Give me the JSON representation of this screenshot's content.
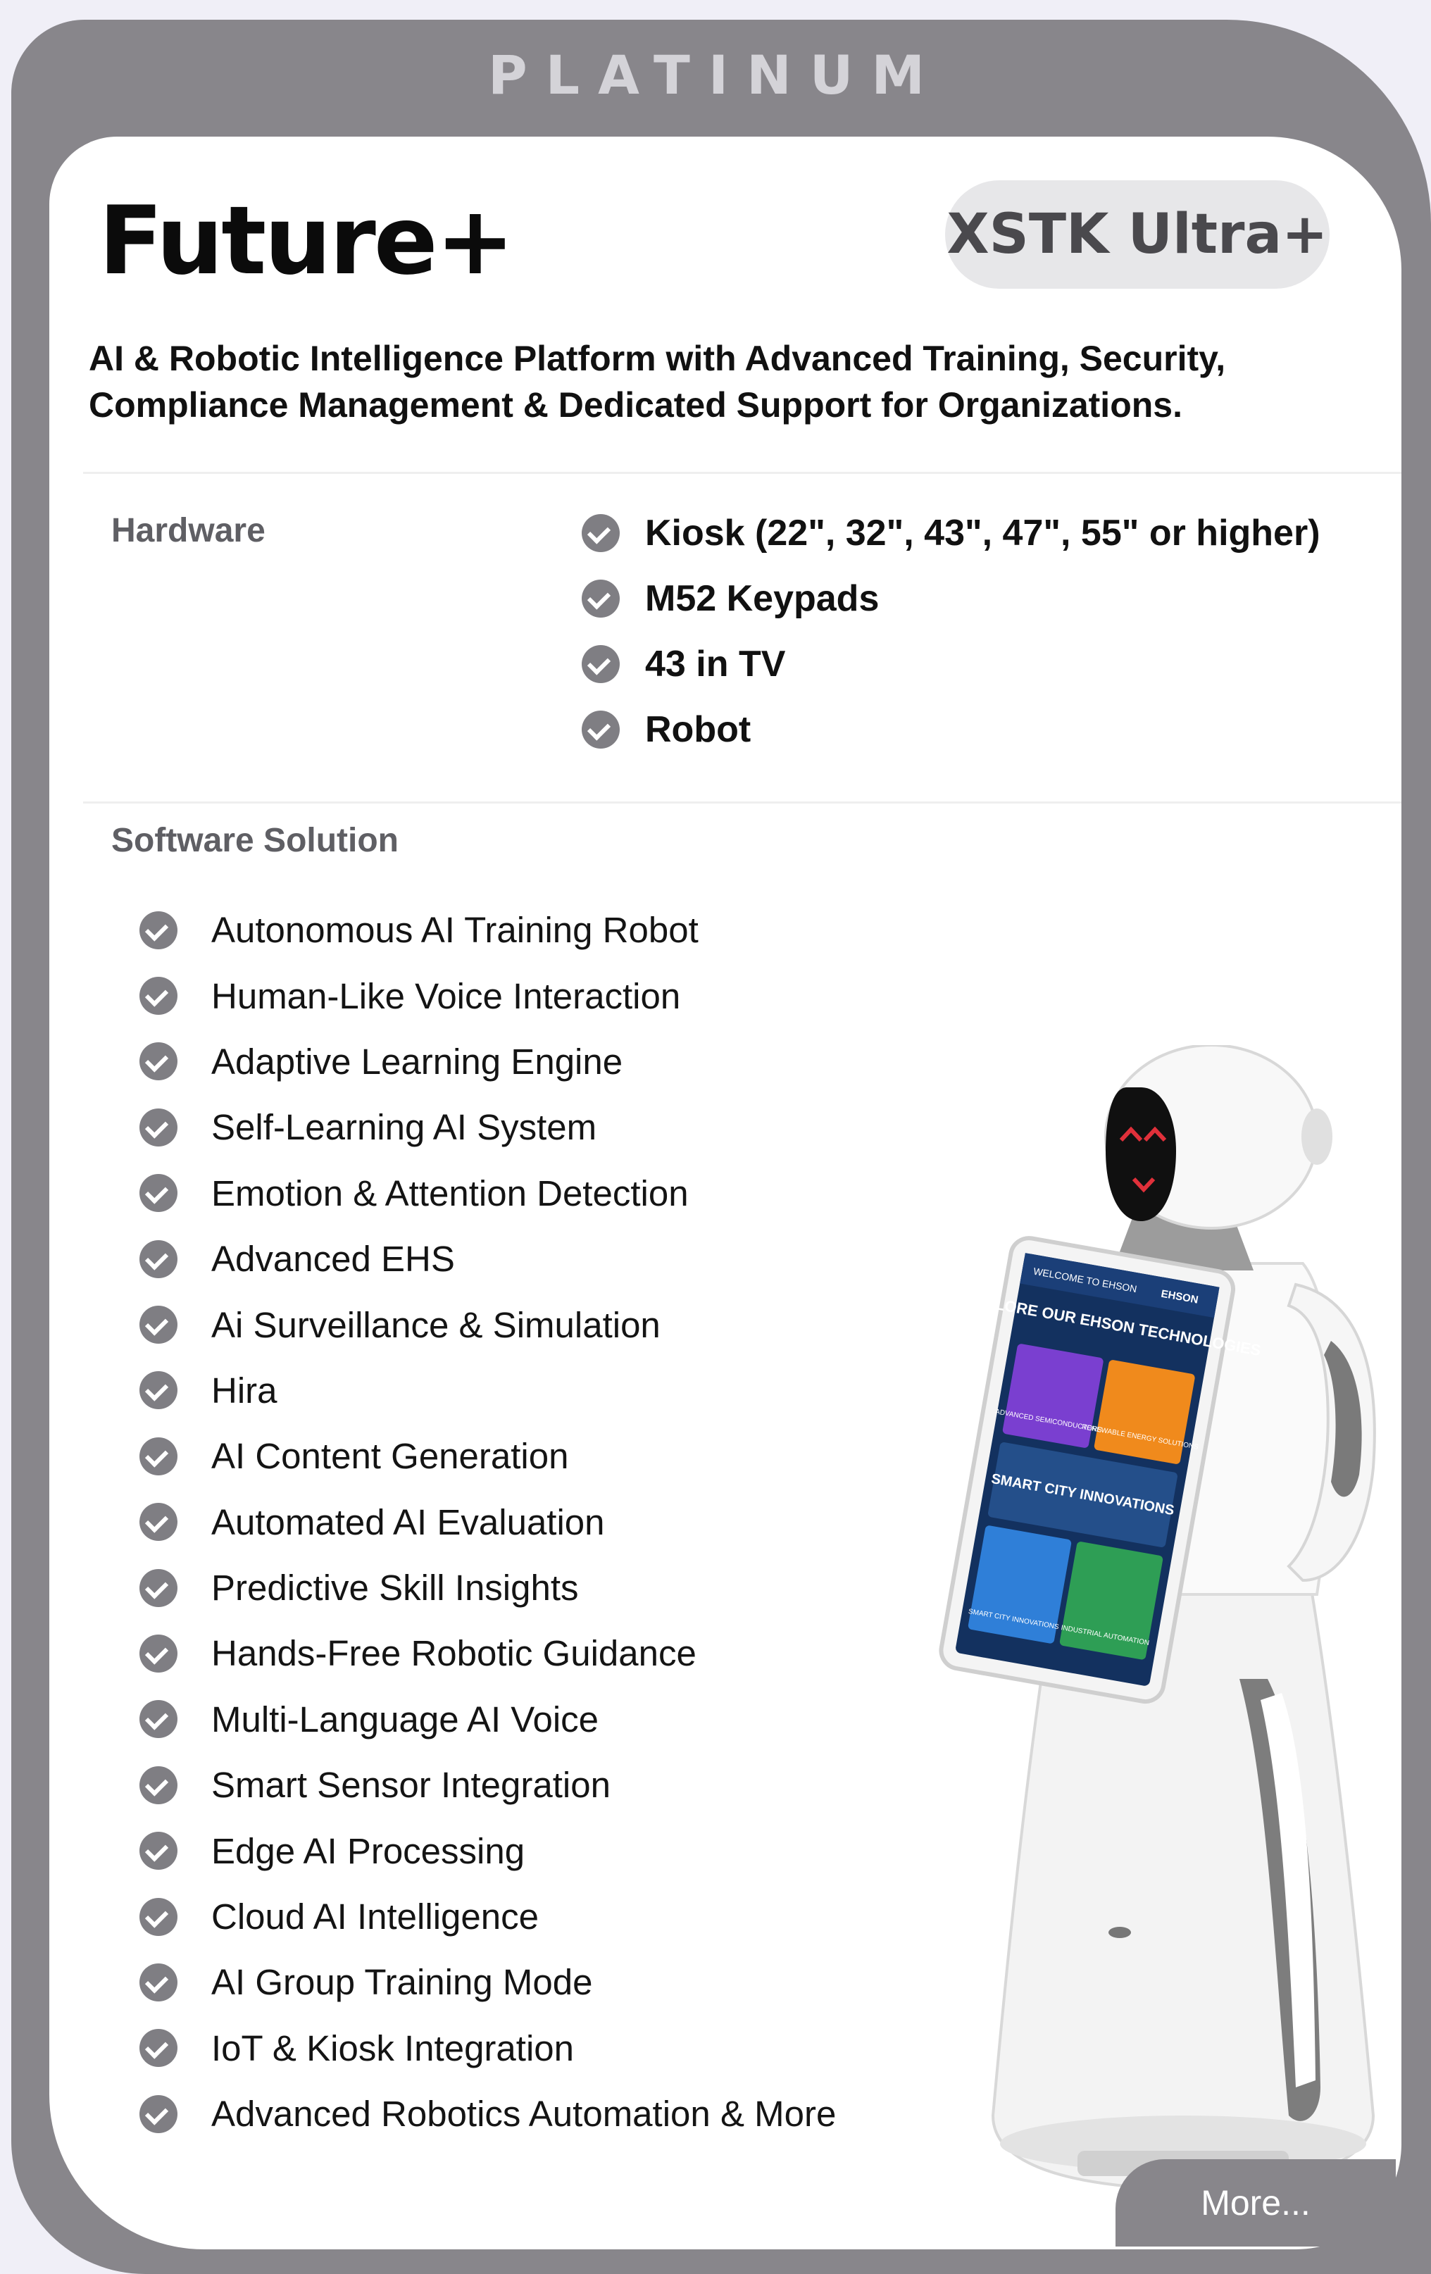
{
  "tier": "PLATINUM",
  "plan": {
    "title": "Future+",
    "model": "XSTK Ultra+",
    "description": "AI & Robotic Intelligence Platform with Advanced Training, Security, Compliance Management & Dedicated Support for Organizations."
  },
  "hardware": {
    "label": "Hardware",
    "items": [
      "Kiosk (22\", 32\", 43\", 47\", 55\" or higher)",
      "M52 Keypads",
      "43 in TV",
      "Robot"
    ]
  },
  "software": {
    "label": "Software Solution",
    "items": [
      "Autonomous AI Training Robot",
      "Human-Like Voice Interaction",
      "Adaptive Learning Engine",
      "Self-Learning AI System",
      "Emotion & Attention Detection",
      "Advanced EHS",
      "Ai Surveillance & Simulation",
      "Hira",
      "AI Content Generation",
      "Automated AI Evaluation",
      "Predictive Skill Insights",
      "Hands-Free Robotic Guidance",
      "Multi-Language AI Voice",
      "Smart Sensor Integration",
      "Edge AI Processing",
      "Cloud AI Intelligence",
      "AI Group Training Mode",
      "IoT & Kiosk Integration",
      "Advanced Robotics Automation & More"
    ]
  },
  "robot_screen": {
    "welcome": "WELCOME TO EHSON",
    "brand": "EHSON",
    "headline": "EXPLORE OUR EHSON TECHNOLOGIES",
    "tiles": [
      "ADVANCED SEMICONDUCTORS",
      "RENEWABLE ENERGY SOLUTIONS"
    ],
    "banner": "SMART CITY INNOVATIONS",
    "bottom_tiles": [
      "SMART CITY INNOVATIONS",
      "INDUSTRIAL AUTOMATION"
    ]
  },
  "more_button": "More...",
  "colors": {
    "frame": "#88868b",
    "check": "#7f7e83",
    "background": "#f0eff7"
  }
}
